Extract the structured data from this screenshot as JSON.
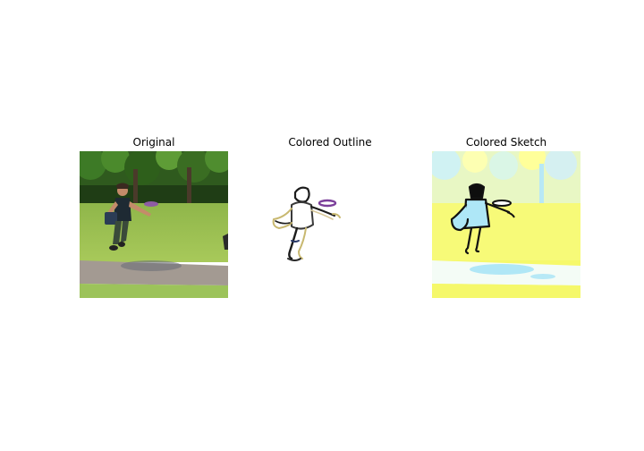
{
  "panels": [
    {
      "title": "Original",
      "image_icon": "photo-boy-throwing-frisbee"
    },
    {
      "title": "Colored Outline",
      "image_icon": "outline-boy-throwing-frisbee"
    },
    {
      "title": "Colored Sketch",
      "image_icon": "sketch-boy-throwing-frisbee"
    }
  ]
}
